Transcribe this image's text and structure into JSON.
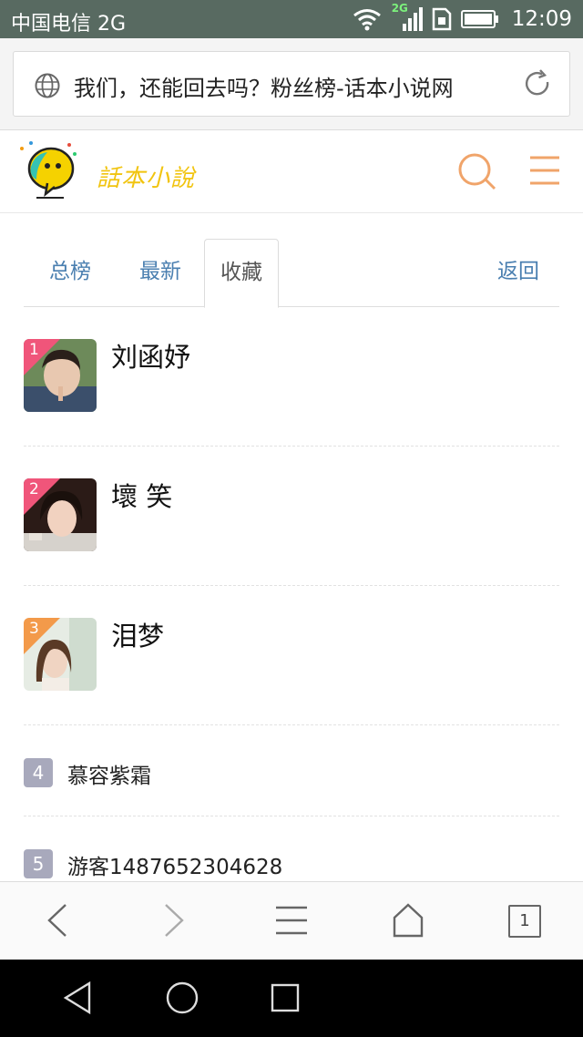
{
  "status_bar": {
    "carrier": "中国电信 2G",
    "network": "2G",
    "time": "12:09"
  },
  "url_bar": {
    "title": "我们，还能回去吗？粉丝榜-话本小说网"
  },
  "site": {
    "logo_text": "話本小說"
  },
  "tabs": [
    {
      "label": "总榜",
      "active": false
    },
    {
      "label": "最新",
      "active": false
    },
    {
      "label": "收藏",
      "active": true
    },
    {
      "label": "返回",
      "active": false
    }
  ],
  "ranking": [
    {
      "rank": "1",
      "name": "刘函妤",
      "corner_color": "#f0557a"
    },
    {
      "rank": "2",
      "name": " 壞 笑",
      "corner_color": "#f0557a"
    },
    {
      "rank": "3",
      "name": "泪梦",
      "corner_color": "#f39a4a"
    },
    {
      "rank": "4",
      "name": "慕容紫霜"
    },
    {
      "rank": "5",
      "name": "游客1487652304628"
    }
  ],
  "toolbar": {
    "tab_count": "1"
  },
  "colors": {
    "status_bar": "#586a61",
    "accent_orange": "#f0a46a",
    "tab_blue": "#4a7fb0",
    "badge_grey": "#a8a9bc"
  }
}
